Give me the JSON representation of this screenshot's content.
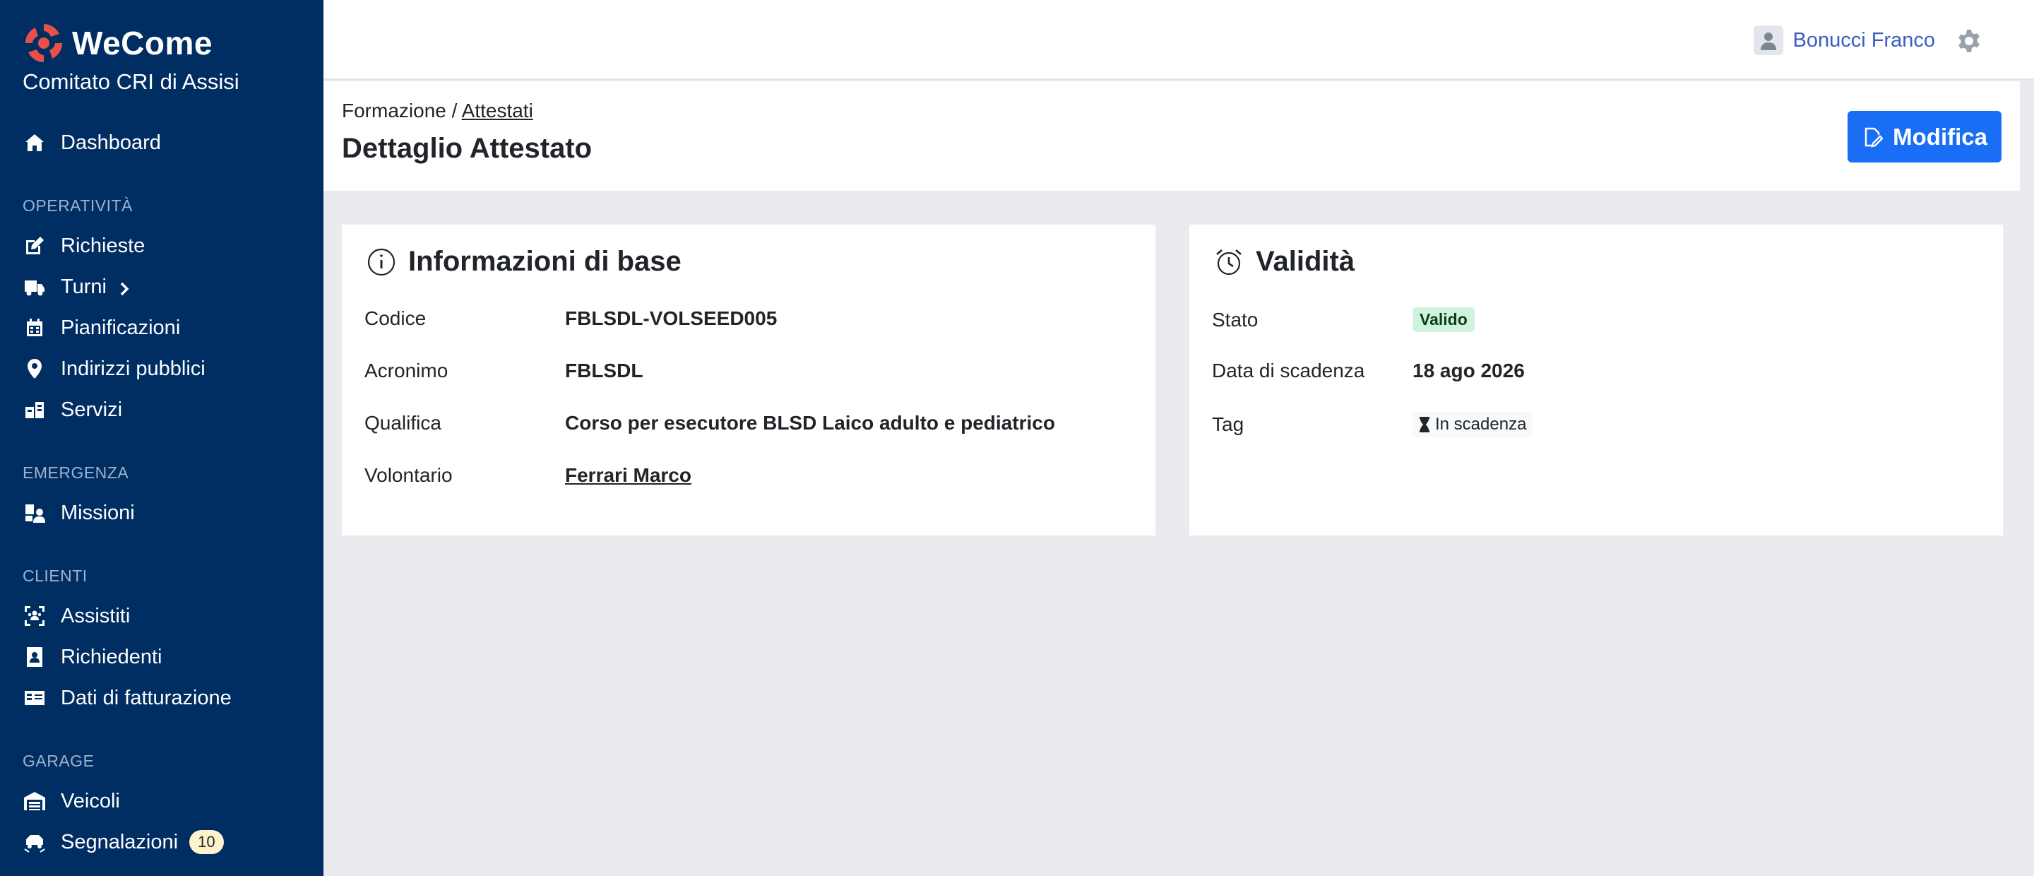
{
  "brand": {
    "name": "WeCome",
    "organization": "Comitato CRI di Assisi",
    "logo_color": "#e8514a"
  },
  "sidebar": {
    "top_items": [
      {
        "label": "Dashboard",
        "icon": "home-icon"
      }
    ],
    "sections": [
      {
        "title": "OPERATIVITÀ",
        "items": [
          {
            "label": "Richieste",
            "icon": "edit-icon"
          },
          {
            "label": "Turni",
            "icon": "truck-icon",
            "has_submenu": true
          },
          {
            "label": "Pianificazioni",
            "icon": "calendar-icon"
          },
          {
            "label": "Indirizzi pubblici",
            "icon": "map-pin-icon"
          },
          {
            "label": "Servizi",
            "icon": "services-icon"
          }
        ]
      },
      {
        "title": "EMERGENZA",
        "items": [
          {
            "label": "Missioni",
            "icon": "mission-icon"
          }
        ]
      },
      {
        "title": "CLIENTI",
        "items": [
          {
            "label": "Assistiti",
            "icon": "people-scan-icon"
          },
          {
            "label": "Richiedenti",
            "icon": "contact-book-icon"
          },
          {
            "label": "Dati di fatturazione",
            "icon": "billing-card-icon"
          }
        ]
      },
      {
        "title": "GARAGE",
        "items": [
          {
            "label": "Veicoli",
            "icon": "garage-icon"
          },
          {
            "label": "Segnalazioni",
            "icon": "vehicle-report-icon",
            "badge": "10"
          }
        ]
      }
    ]
  },
  "topbar": {
    "user_name": "Bonucci Franco"
  },
  "header": {
    "breadcrumb_root": "Formazione",
    "breadcrumb_separator": "/",
    "breadcrumb_link": "Attestati",
    "title": "Dettaglio Attestato",
    "edit_button": "Modifica",
    "accent_color": "#1a6ef5"
  },
  "info_card": {
    "title": "Informazioni di base",
    "rows": [
      {
        "label": "Codice",
        "value": "FBLSDL-VOLSEED005"
      },
      {
        "label": "Acronimo",
        "value": "FBLSDL"
      },
      {
        "label": "Qualifica",
        "value": "Corso per esecutore BLSD Laico adulto e pediatrico"
      },
      {
        "label": "Volontario",
        "value": "Ferrari Marco"
      }
    ]
  },
  "validity_card": {
    "title": "Validità",
    "rows": [
      {
        "label": "Stato",
        "value": "Valido"
      },
      {
        "label": "Data di scadenza",
        "value": "18 ago 2026"
      },
      {
        "label": "Tag",
        "value": "In scadenza"
      }
    ],
    "status_color": "#d1f2dc"
  }
}
